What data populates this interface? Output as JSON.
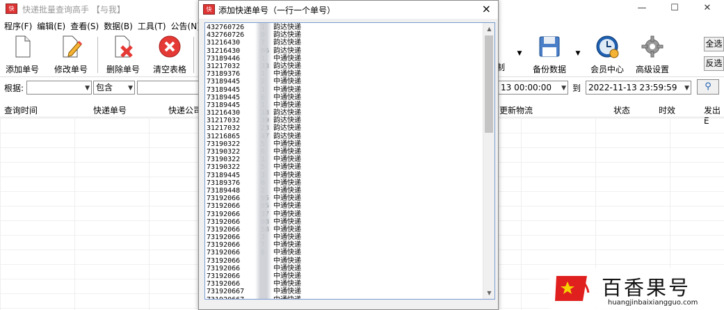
{
  "main": {
    "title": "快递批量查询高手 【与我】",
    "menu": [
      "程序(F)",
      "编辑(E)",
      "查看(S)",
      "数据(B)",
      "工具(T)",
      "公告(N)"
    ],
    "toolbar": {
      "add": "添加单号",
      "edit": "修改单号",
      "delete": "删除单号",
      "clear": "清空表格",
      "partial_copy": "制",
      "backup": "备份数据",
      "member": "会员中心",
      "advanced": "高级设置"
    },
    "filter": {
      "label": "根据:",
      "match": "包含",
      "start_time": "13 00:00:00",
      "to": "到",
      "end_time": "2022-11-13 23:59:59"
    },
    "side_buttons": [
      "全选",
      "反选"
    ],
    "columns": [
      "查询时间",
      "快递单号",
      "快递公司",
      "更新物流",
      "状态",
      "时效",
      "发出E"
    ]
  },
  "dialog": {
    "title": "添加快递单号（一行一个单号）",
    "close": "×",
    "lines": [
      {
        "num": "432760726",
        "tail": "1",
        "carrier": "韵达快递"
      },
      {
        "num": "432760726",
        "tail": "0",
        "carrier": "韵达快递"
      },
      {
        "num": "31216430",
        "tail": "7",
        "carrier": "韵达快递"
      },
      {
        "num": "31216430",
        "tail": "06",
        "carrier": "韵达快递"
      },
      {
        "num": "73189446",
        "tail": "1",
        "carrier": "中通快递"
      },
      {
        "num": "31217032",
        "tail": "33",
        "carrier": "韵达快递"
      },
      {
        "num": "73189376",
        "tail": "1",
        "carrier": "中通快递"
      },
      {
        "num": "73189445",
        "tail": "2",
        "carrier": "中通快递"
      },
      {
        "num": "73189445",
        "tail": "1",
        "carrier": "中通快递"
      },
      {
        "num": "73189445",
        "tail": "6",
        "carrier": "中通快递"
      },
      {
        "num": "73189445",
        "tail": "1",
        "carrier": "中通快递"
      },
      {
        "num": "31216430",
        "tail": "18",
        "carrier": "韵达快递"
      },
      {
        "num": "31217032",
        "tail": "39",
        "carrier": "韵达快递"
      },
      {
        "num": "31217032",
        "tail": "23",
        "carrier": "韵达快递"
      },
      {
        "num": "31216865",
        "tail": "47",
        "carrier": "韵达快递"
      },
      {
        "num": "73190322",
        "tail": "5",
        "carrier": "中通快递"
      },
      {
        "num": "73190322",
        "tail": "6",
        "carrier": "中通快递"
      },
      {
        "num": "73190322",
        "tail": "1",
        "carrier": "中通快递"
      },
      {
        "num": "73190322",
        "tail": "5",
        "carrier": "中通快递"
      },
      {
        "num": "73189445",
        "tail": "3",
        "carrier": "中通快递"
      },
      {
        "num": "73189376",
        "tail": "0",
        "carrier": "中通快递"
      },
      {
        "num": "73189448",
        "tail": "2",
        "carrier": "中通快递"
      },
      {
        "num": "73192066",
        "tail": "95",
        "carrier": "中通快递"
      },
      {
        "num": "73192066",
        "tail": "95",
        "carrier": "中通快递"
      },
      {
        "num": "73192066",
        "tail": "37",
        "carrier": "中通快递"
      },
      {
        "num": "73192066",
        "tail": "98",
        "carrier": "中通快递"
      },
      {
        "num": "73192066",
        "tail": "58",
        "carrier": "中通快递"
      },
      {
        "num": "73192066",
        "tail": "3",
        "carrier": "中通快递"
      },
      {
        "num": "73192066",
        "tail": "7",
        "carrier": "中通快递"
      },
      {
        "num": "73192066",
        "tail": "6",
        "carrier": "中通快递"
      },
      {
        "num": "73192066",
        "tail": "",
        "carrier": "中通快递"
      },
      {
        "num": "73192066",
        "tail": "",
        "carrier": "中通快递"
      },
      {
        "num": "73192066",
        "tail": "",
        "carrier": "中通快递"
      },
      {
        "num": "73192066",
        "tail": "",
        "carrier": "中通快递"
      },
      {
        "num": "731920667",
        "tail": "",
        "carrier": "中通快递"
      },
      {
        "num": "731920667",
        "tail": "",
        "carrier": "中通快递"
      }
    ]
  },
  "watermark": {
    "brand": "百香果号",
    "url": "huangjinbaixiangguo.com"
  },
  "colors": {
    "delete_red": "#e53935",
    "member_blue": "#1e5fb0",
    "watermark_red": "#e0201f"
  }
}
